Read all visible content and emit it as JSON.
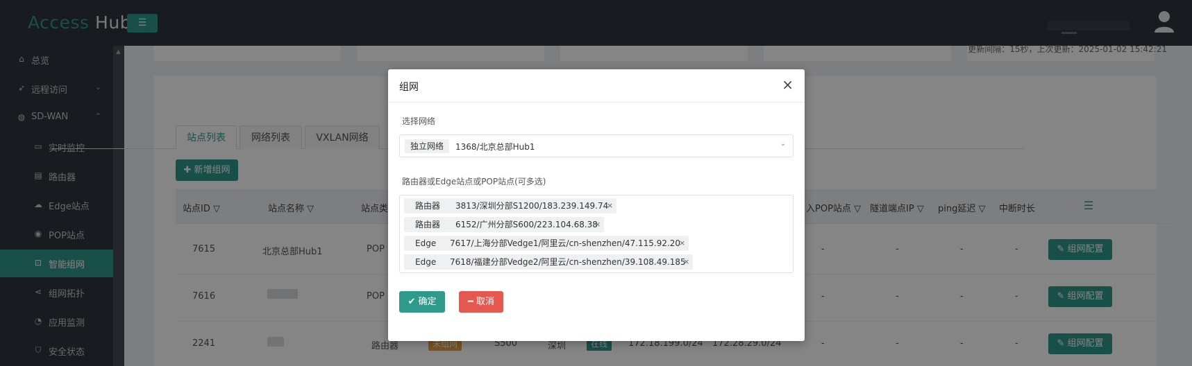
{
  "app": {
    "brand_part1": "Access",
    "brand_part2": "Hub",
    "menu_toggle": "☰"
  },
  "sidebar": {
    "items": [
      {
        "label": "总览",
        "icon": "home-icon"
      },
      {
        "label": "远程访问",
        "icon": "rocket-icon"
      },
      {
        "label": "SD-WAN",
        "icon": "globe-icon"
      },
      {
        "label": "实时监控",
        "icon": "monitor-icon"
      },
      {
        "label": "路由器",
        "icon": "router-icon"
      },
      {
        "label": "Edge站点",
        "icon": "cloud-icon"
      },
      {
        "label": "POP站点",
        "icon": "pin-icon"
      },
      {
        "label": "智能组网",
        "icon": "lock-icon"
      },
      {
        "label": "组网拓扑",
        "icon": "share-icon"
      },
      {
        "label": "应用监测",
        "icon": "pie-icon"
      },
      {
        "label": "安全状态",
        "icon": "shield-icon"
      }
    ],
    "active": "智能组网"
  },
  "page": {
    "refresh_note": "更新间隔：15秒，上次更新：2025-01-02 15:42:21",
    "tabs": [
      "站点列表",
      "网络列表",
      "VXLAN网络"
    ],
    "new_button": "新增组网",
    "columns": {
      "site_id": "站点ID",
      "site_name": "站点名称",
      "site_type": "站点类型",
      "pop_site": "入POP站点",
      "tunnel_ip": "隧道端点IP",
      "ping": "ping延迟",
      "interrupt": "中断时长"
    },
    "rows": [
      {
        "id": "7615",
        "name": "北京总部Hub1",
        "type": "POP",
        "pop": "-",
        "tunnel": "-",
        "ping": "-",
        "interrupt": "-",
        "action": "组网配置"
      },
      {
        "id": "7616",
        "name": "",
        "type": "POP",
        "pop": "-",
        "tunnel": "-",
        "ping": "-",
        "interrupt": "-",
        "action": "组网配置"
      },
      {
        "id": "2241",
        "name": "",
        "type": "路由器",
        "status_badge": "未组网",
        "model": "S500",
        "city": "深圳",
        "online": "在线",
        "lan": "172.18.199.0/24",
        "lan2": "172.28.29.0/24",
        "pop": "-",
        "tunnel": "-",
        "ping": "-",
        "interrupt": "-",
        "action": "组网配置"
      }
    ]
  },
  "modal": {
    "title": "组网",
    "close": "×",
    "network_label": "选择网络",
    "network_tag": "独立网络",
    "network_value": "1368/北京总部Hub1",
    "sites_label": "路由器或Edge站点或POP站点(可多选)",
    "selected": [
      {
        "kind": "路由器",
        "value": "3813/深圳分部S1200/183.239.149.74"
      },
      {
        "kind": "路由器",
        "value": "6152/广州分部S600/223.104.68.38"
      },
      {
        "kind": "Edge",
        "value": "7617/上海分部Vedge1/阿里云/cn-shenzhen/47.115.92.20"
      },
      {
        "kind": "Edge",
        "value": "7618/福建分部Vedge2/阿里云/cn-shenzhen/39.108.49.185"
      }
    ],
    "ok": "确定",
    "cancel": "取消"
  },
  "colors": {
    "accent": "#2f9a8c",
    "danger": "#e5584f",
    "sidebar_bg": "#2f353d",
    "badge_warn": "#e6a23c"
  }
}
